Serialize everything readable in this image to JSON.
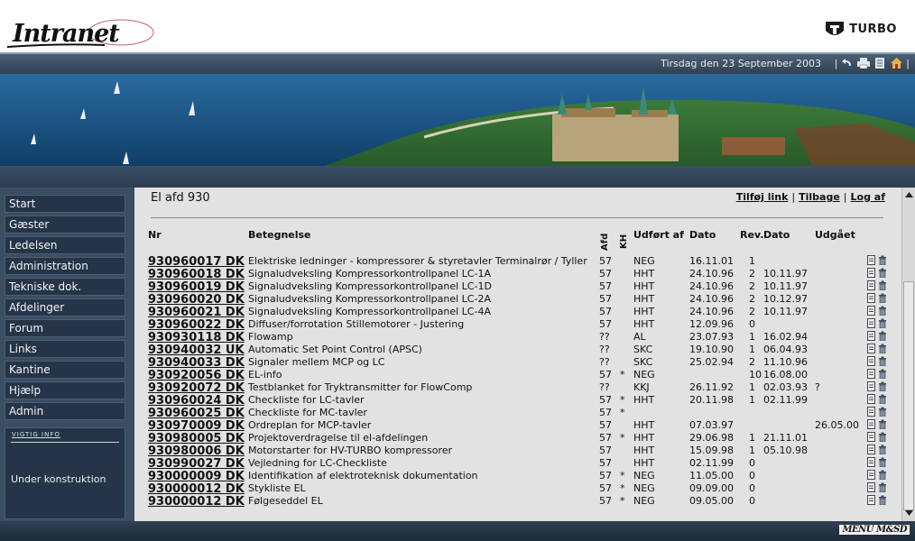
{
  "brand": {
    "logo_text": "Intranet",
    "company": "TURBO"
  },
  "header": {
    "date": "Tirsdag den 23 September 2003"
  },
  "sidebar": {
    "items": [
      {
        "label": "Start"
      },
      {
        "label": "Gæster"
      },
      {
        "label": "Ledelsen"
      },
      {
        "label": "Administration"
      },
      {
        "label": "Tekniske dok."
      },
      {
        "label": "Afdelinger"
      },
      {
        "label": "Forum"
      },
      {
        "label": "Links"
      },
      {
        "label": "Kantine"
      },
      {
        "label": "Hjælp"
      },
      {
        "label": "Admin"
      }
    ],
    "info": {
      "title": "VIGTIG INFO",
      "text": "Under konstruktion"
    }
  },
  "main": {
    "title": "El afd 930",
    "links": {
      "add": "Tilføj link",
      "back": "Tilbage",
      "logout": "Log af"
    },
    "columns": {
      "nr": "Nr",
      "betegnelse": "Betegnelse",
      "afd": "Afd",
      "kh": "KH",
      "udfort": "Udført af",
      "dato": "Dato",
      "rev": "Rev.",
      "revdato": "Dato",
      "udgaet": "Udgået"
    },
    "rows": [
      {
        "nr": "930960017 DK",
        "bet": "Elektriske ledninger - kompressorer & styretavler Terminalrør / Tyller",
        "afd": "57",
        "kh": "",
        "udf": "NEG",
        "dato": "16.11.01",
        "rev": "1",
        "dato2": "",
        "udg": ""
      },
      {
        "nr": "930960018 DK",
        "bet": "Signaludveksling Kompressorkontrollpanel LC-1A",
        "afd": "57",
        "kh": "",
        "udf": "HHT",
        "dato": "24.10.96",
        "rev": "2",
        "dato2": "10.11.97",
        "udg": ""
      },
      {
        "nr": "930960019 DK",
        "bet": "Signaludveksling Kompressorkontrollpanel LC-1D",
        "afd": "57",
        "kh": "",
        "udf": "HHT",
        "dato": "24.10.96",
        "rev": "2",
        "dato2": "10.11.97",
        "udg": ""
      },
      {
        "nr": "930960020 DK",
        "bet": "Signaludveksling Kompressorkontrollpanel LC-2A",
        "afd": "57",
        "kh": "",
        "udf": "HHT",
        "dato": "24.10.96",
        "rev": "2",
        "dato2": "10.12.97",
        "udg": ""
      },
      {
        "nr": "930960021 DK",
        "bet": "Signaludveksling Kompressorkontrollpanel LC-4A",
        "afd": "57",
        "kh": "",
        "udf": "HHT",
        "dato": "24.10.96",
        "rev": "2",
        "dato2": "10.11.97",
        "udg": ""
      },
      {
        "nr": "930960022 DK",
        "bet": "Diffuser/forrotation Stillemotorer - Justering",
        "afd": "57",
        "kh": "",
        "udf": "HHT",
        "dato": "12.09.96",
        "rev": "0",
        "dato2": "",
        "udg": ""
      },
      {
        "nr": "930930118 DK",
        "bet": "Flowamp",
        "afd": "??",
        "kh": "",
        "udf": "AL",
        "dato": "23.07.93",
        "rev": "1",
        "dato2": "16.02.94",
        "udg": ""
      },
      {
        "nr": "930940032 UK",
        "bet": "Automatic Set Point Control (APSC)",
        "afd": "??",
        "kh": "",
        "udf": "SKC",
        "dato": "19.10.90",
        "rev": "1",
        "dato2": "06.04.93",
        "udg": ""
      },
      {
        "nr": "930940033 DK",
        "bet": "Signaler mellem MCP og LC",
        "afd": "??",
        "kh": "",
        "udf": "SKC",
        "dato": "25.02.94",
        "rev": "2",
        "dato2": "11.10.96",
        "udg": ""
      },
      {
        "nr": "930920056 DK",
        "bet": "EL-info",
        "afd": "57",
        "kh": "*",
        "udf": "NEG",
        "dato": "",
        "rev": "10",
        "dato2": "16.08.00",
        "udg": ""
      },
      {
        "nr": "930920072 DK",
        "bet": "Testblanket for Tryktransmitter for FlowComp",
        "afd": "??",
        "kh": "",
        "udf": "KKJ",
        "dato": "26.11.92",
        "rev": "1",
        "dato2": "02.03.93",
        "udg": "?"
      },
      {
        "nr": "930960024 DK",
        "bet": "Checkliste for LC-tavler",
        "afd": "57",
        "kh": "*",
        "udf": "HHT",
        "dato": "20.11.98",
        "rev": "1",
        "dato2": "02.11.99",
        "udg": ""
      },
      {
        "nr": "930960025 DK",
        "bet": "Checkliste for MC-tavler",
        "afd": "57",
        "kh": "*",
        "udf": "",
        "dato": "",
        "rev": "",
        "dato2": "",
        "udg": ""
      },
      {
        "nr": "930970009 DK",
        "bet": "Ordreplan for MCP-tavler",
        "afd": "57",
        "kh": "",
        "udf": "HHT",
        "dato": "07.03.97",
        "rev": "",
        "dato2": "",
        "udg": "26.05.00"
      },
      {
        "nr": "930980005 DK",
        "bet": "Projektoverdragelse til el-afdelingen",
        "afd": "57",
        "kh": "*",
        "udf": "HHT",
        "dato": "29.06.98",
        "rev": "1",
        "dato2": "21.11.01",
        "udg": ""
      },
      {
        "nr": "930980006 DK",
        "bet": "Motorstarter for HV-TURBO kompressorer",
        "afd": "57",
        "kh": "",
        "udf": "HHT",
        "dato": "15.09.98",
        "rev": "1",
        "dato2": "05.10.98",
        "udg": ""
      },
      {
        "nr": "930990027 DK",
        "bet": "Vejledning for LC-Checkliste",
        "afd": "57",
        "kh": "",
        "udf": "HHT",
        "dato": "02.11.99",
        "rev": "0",
        "dato2": "",
        "udg": ""
      },
      {
        "nr": "930000009 DK",
        "bet": "Identifikation af elektroteknisk dokumentation",
        "afd": "57",
        "kh": "*",
        "udf": "NEG",
        "dato": "11.05.00",
        "rev": "0",
        "dato2": "",
        "udg": ""
      },
      {
        "nr": "930000012 DK",
        "bet": "Stykliste EL",
        "afd": "57",
        "kh": "*",
        "udf": "NEG",
        "dato": "09.09.00",
        "rev": "0",
        "dato2": "",
        "udg": ""
      },
      {
        "nr": "930000012 DK",
        "bet": "Følgeseddel EL",
        "afd": "57",
        "kh": "*",
        "udf": "NEG",
        "dato": "09.05.00",
        "rev": "0",
        "dato2": "",
        "udg": ""
      }
    ]
  },
  "footer": {
    "signature": "MENU M&SD"
  }
}
